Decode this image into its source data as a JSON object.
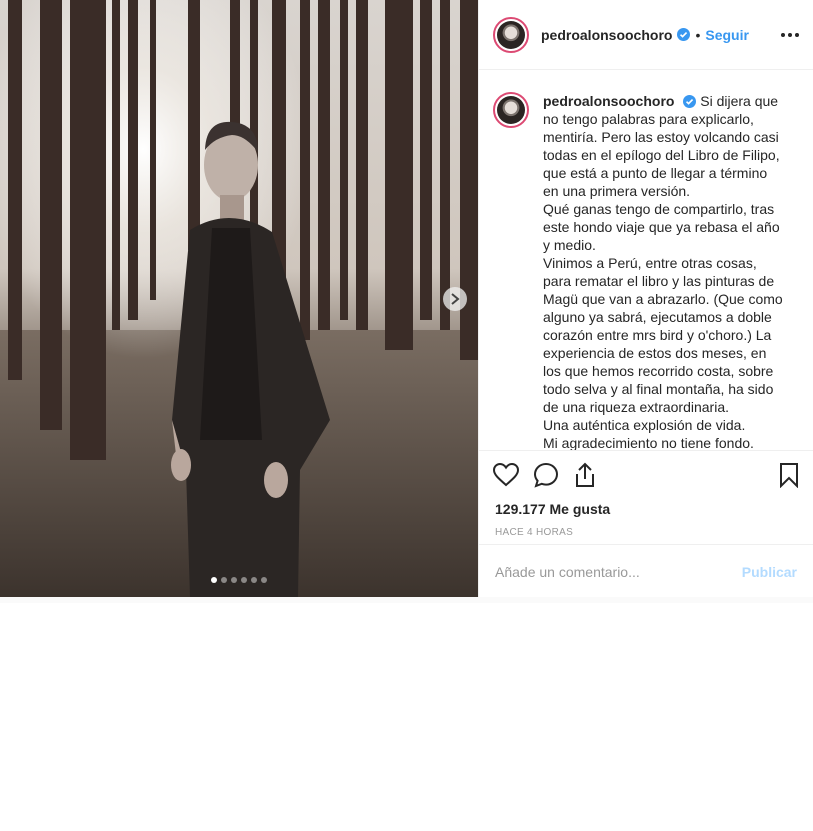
{
  "post": {
    "username": "pedroalonsoochoro",
    "verified": true,
    "separator": "•",
    "follow_label": "Seguir",
    "more_icon": "more-options-icon"
  },
  "caption": {
    "username": "pedroalonsoochoro",
    "text": "Si dijera que no tengo palabras para explicarlo, mentiría. Pero las estoy volcando casi todas en el epílogo del Libro de Filipo, que está a punto de llegar a término en una primera versión.\nQué ganas tengo de compartirlo, tras este hondo viaje que ya rebasa el año y medio.\nVinimos a Perú, entre otras cosas, para rematar el libro y las pinturas de Magü que van a abrazarlo. (Que como alguno ya sabrá, ejecutamos a doble corazón entre mrs bird y o'choro.) La experiencia de estos dos meses, en los que hemos recorrido costa, sobre todo selva y al final montaña, ha sido de una riqueza extraordinaria.\nUna auténtica explosión de vida.\nMi agradecimiento no tiene fondo."
  },
  "stats": {
    "likes": "129.177 Me gusta",
    "time": "HACE 4 HORAS"
  },
  "comment": {
    "placeholder": "Añade un comentario...",
    "publish_label": "Publicar"
  },
  "carousel": {
    "total_slides": 6,
    "active_index": 0
  },
  "colors": {
    "accent": "#3897f0",
    "publish_disabled": "#b3dbff",
    "text": "#262626",
    "muted": "#999999"
  }
}
